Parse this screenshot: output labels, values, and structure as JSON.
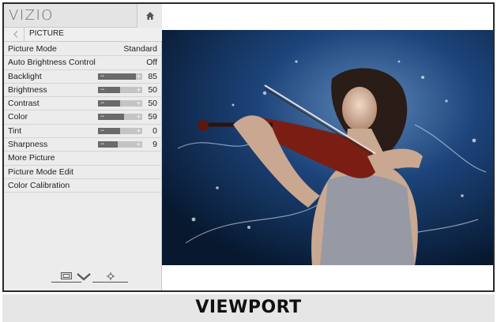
{
  "brand": "VIZIO",
  "breadcrumb": "PICTURE",
  "menu": {
    "rows": [
      {
        "label": "Picture Mode",
        "value": "Standard"
      },
      {
        "label": "Auto Brightness Control",
        "value": "Off"
      },
      {
        "label": "Backlight",
        "value": "85",
        "level": 0.85
      },
      {
        "label": "Brightness",
        "value": "50",
        "level": 0.5
      },
      {
        "label": "Contrast",
        "value": "50",
        "level": 0.5
      },
      {
        "label": "Color",
        "value": "59",
        "level": 0.59
      },
      {
        "label": "Tint",
        "value": "0",
        "level": 0.5
      },
      {
        "label": "Sharpness",
        "value": "9",
        "level": 0.45
      },
      {
        "label": "More Picture"
      },
      {
        "label": "Picture Mode Edit"
      },
      {
        "label": "Color Calibration"
      }
    ]
  },
  "slider_symbols": {
    "minus": "−",
    "plus": "+"
  },
  "footer": {
    "icons": [
      "picture-icon",
      "down-chevron-icon",
      "settings-icon"
    ]
  },
  "bottom_label": "VIEWPORT",
  "colors": {
    "menu_bg": "#ececec",
    "slider_fill": "#6a6a6a",
    "slider_track": "#c4c4c4",
    "photo_bg": "#0e2a52"
  }
}
